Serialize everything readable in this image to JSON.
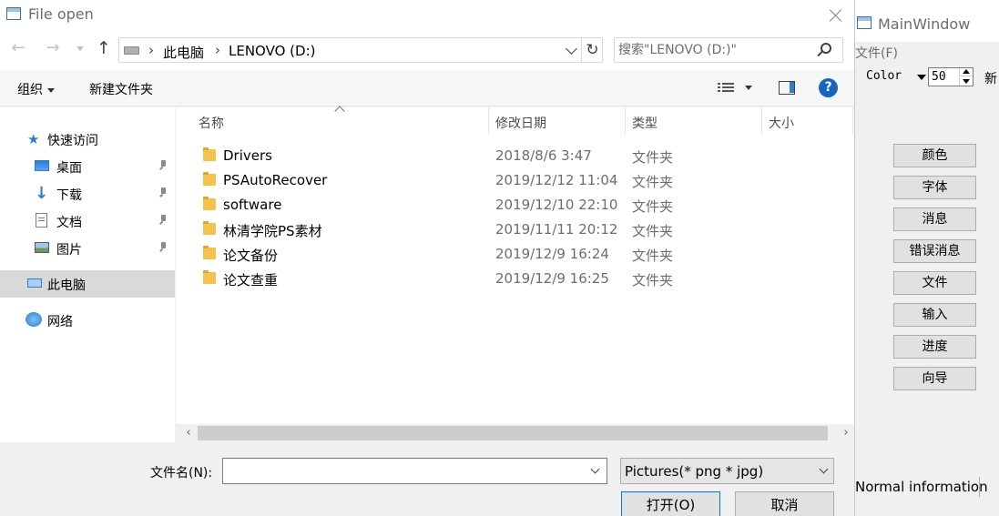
{
  "main_window": {
    "title": "MainWindow",
    "menu_file": "文件(F)",
    "toolbar": {
      "color_label": "Color",
      "size_value": "50",
      "new_label": "新"
    },
    "buttons": [
      "颜色",
      "字体",
      "消息",
      "错误消息",
      "文件",
      "输入",
      "进度",
      "向导"
    ],
    "status_text": "Normal information"
  },
  "dialog": {
    "title": "File open",
    "address": {
      "segments": [
        "此电脑",
        "LENOVO (D:)"
      ]
    },
    "search_placeholder": "搜索\"LENOVO (D:)\"",
    "commands": {
      "organize": "组织",
      "new_folder": "新建文件夹"
    },
    "nav": {
      "quick_access": "快速访问",
      "items": [
        "桌面",
        "下载",
        "文档",
        "图片"
      ],
      "this_pc": "此电脑",
      "network": "网络"
    },
    "columns": {
      "name": "名称",
      "date": "修改日期",
      "type": "类型",
      "size": "大小"
    },
    "files": [
      {
        "name": "Drivers",
        "date": "2018/8/6 3:47",
        "type": "文件夹"
      },
      {
        "name": "PSAutoRecover",
        "date": "2019/12/12 11:04",
        "type": "文件夹"
      },
      {
        "name": "software",
        "date": "2019/12/10 22:10",
        "type": "文件夹"
      },
      {
        "name": "林清学院PS素材",
        "date": "2019/11/11 20:12",
        "type": "文件夹"
      },
      {
        "name": "论文备份",
        "date": "2019/12/9 16:24",
        "type": "文件夹"
      },
      {
        "name": "论文查重",
        "date": "2019/12/9 16:25",
        "type": "文件夹"
      }
    ],
    "filename_label": "文件名(N):",
    "filename_value": "",
    "filter_value": "Pictures(* png * jpg)",
    "open_label": "打开(O)",
    "cancel_label": "取消"
  },
  "colors": {
    "accent": "#0078d7",
    "folder": "#f5c24b",
    "help": "#1565c0"
  }
}
